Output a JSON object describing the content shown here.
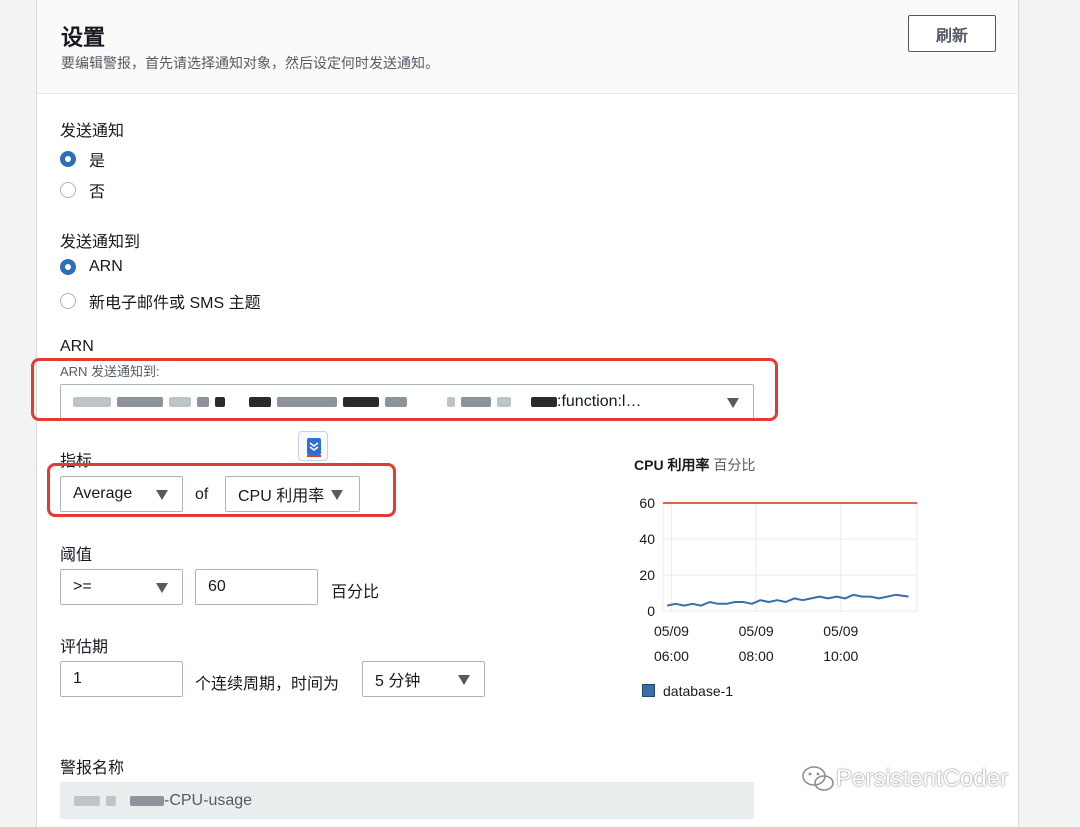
{
  "header": {
    "title": "设置",
    "description": "要编辑警报，首先请选择通知对象，然后设定何时发送通知。",
    "refresh_label": "刷新"
  },
  "send_notification": {
    "label": "发送通知",
    "options": [
      "是",
      "否"
    ],
    "selected": "是"
  },
  "send_to": {
    "label": "发送通知到",
    "options": [
      "ARN",
      "新电子邮件或 SMS 主题"
    ],
    "selected": "ARN"
  },
  "arn": {
    "label": "ARN",
    "sublabel": "ARN 发送通知到:",
    "value_suffix": ":function:l…"
  },
  "metric": {
    "label": "指标",
    "statistic": "Average",
    "of_label": "of",
    "metric_name": "CPU 利用率"
  },
  "threshold": {
    "label": "阈值",
    "operator": ">=",
    "value": "60",
    "unit": "百分比"
  },
  "evaluation": {
    "label": "评估期",
    "periods": "1",
    "text": "个连续周期，时间为",
    "period_length": "5 分钟"
  },
  "alarm_name": {
    "label": "警报名称",
    "value_suffix": "-CPU-usage"
  },
  "chart_data": {
    "type": "line",
    "title": "CPU 利用率",
    "unit": "百分比",
    "ylim": [
      0,
      60
    ],
    "yticks": [
      "60",
      "40",
      "20",
      "0"
    ],
    "xticks": [
      {
        "date": "05/09",
        "time": "06:00"
      },
      {
        "date": "05/09",
        "time": "08:00"
      },
      {
        "date": "05/09",
        "time": "10:00"
      }
    ],
    "threshold": 60,
    "x_hours": [
      5.9,
      6.1,
      6.3,
      6.5,
      6.7,
      6.9,
      7.1,
      7.3,
      7.5,
      7.7,
      7.9,
      8.1,
      8.3,
      8.5,
      8.7,
      8.9,
      9.1,
      9.3,
      9.5,
      9.7,
      9.9,
      10.1,
      10.3,
      10.5,
      10.7,
      10.9,
      11.1,
      11.3,
      11.6
    ],
    "series": [
      {
        "name": "database-1",
        "values": [
          3,
          4,
          3,
          4,
          3,
          5,
          4,
          4,
          5,
          5,
          4,
          6,
          5,
          6,
          5,
          7,
          6,
          7,
          8,
          7,
          8,
          7,
          9,
          8,
          8,
          7,
          8,
          9,
          8
        ]
      }
    ],
    "colors": {
      "series": "#3a6ea8",
      "threshold": "#d13212",
      "grid": "#e9ebed"
    }
  },
  "watermark": "PersistentCoder"
}
